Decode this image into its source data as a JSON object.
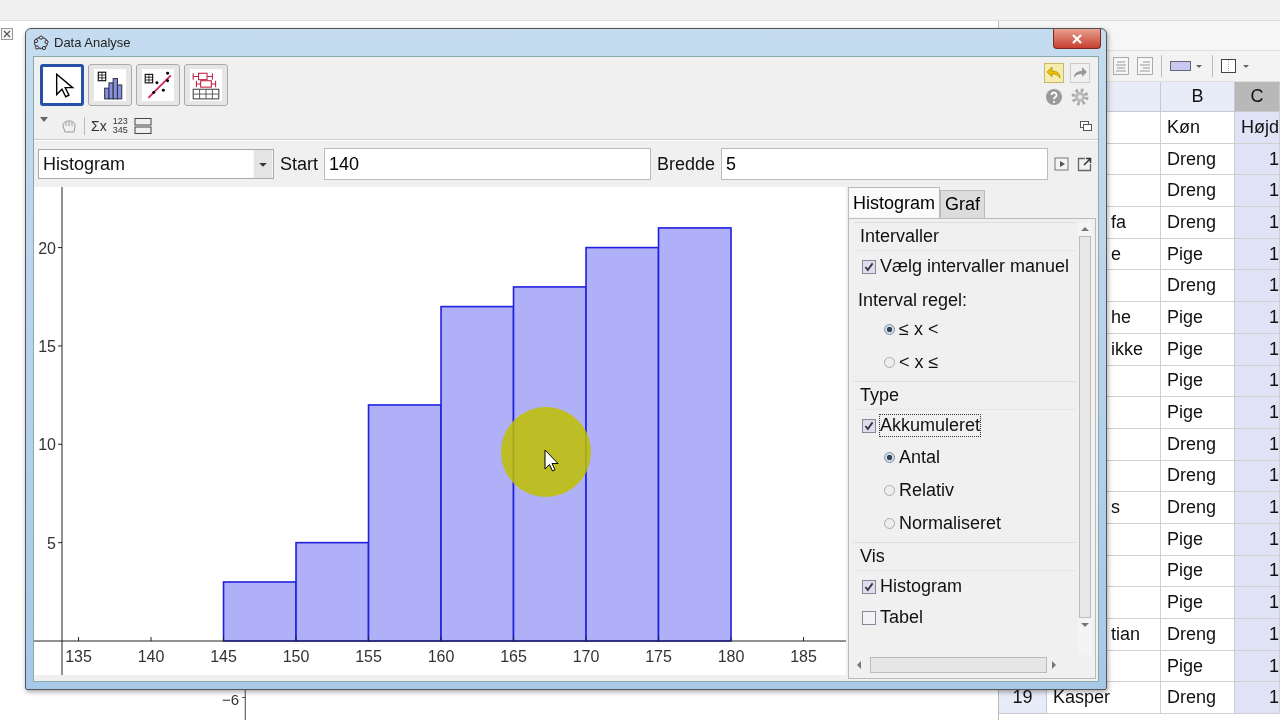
{
  "window": {
    "title": "Data Analyse"
  },
  "toolbar": {
    "modes": [
      {
        "kind": "pointer",
        "selected": true
      },
      {
        "kind": "histogram",
        "selected": false
      },
      {
        "kind": "scatter",
        "selected": false
      },
      {
        "kind": "boxplot",
        "selected": false
      }
    ],
    "statistics_button": "Σx",
    "data_button_lines": [
      "123",
      "345"
    ]
  },
  "controls": {
    "chart_type": "Histogram",
    "start_label": "Start",
    "start_value": "140",
    "width_label": "Bredde",
    "width_value": "5"
  },
  "chart": {
    "chart_data": {
      "type": "bar",
      "x": [
        142.5,
        147.5,
        152.5,
        157.5,
        162.5,
        167.5,
        172.5,
        177.5
      ],
      "values": [
        0,
        3,
        5,
        12,
        17,
        18,
        20,
        21
      ],
      "xlim": [
        133.86,
        187.93
      ],
      "ylim": [
        0,
        23.08
      ],
      "xticks": [
        135,
        140,
        145,
        150,
        155,
        160,
        165,
        170,
        175,
        180,
        185
      ],
      "yticks": [
        5,
        10,
        15,
        20
      ]
    }
  },
  "options": {
    "tabs": [
      {
        "label": "Histogram",
        "selected": true
      },
      {
        "label": "Graf",
        "selected": false
      }
    ],
    "sections": [
      {
        "title": "Intervaller",
        "items": [
          {
            "kind": "checkbox",
            "label": "Vælg intervaller manuel",
            "checked": true,
            "focused": false
          },
          {
            "kind": "caption",
            "label": "Interval regel:"
          },
          {
            "kind": "radio",
            "label": "≤ x <",
            "selected": true
          },
          {
            "kind": "radio",
            "label": "< x ≤",
            "selected": false
          }
        ]
      },
      {
        "title": "Type",
        "items": [
          {
            "kind": "checkbox",
            "label": "Akkumuleret",
            "checked": true,
            "focused": true
          },
          {
            "kind": "radio",
            "label": "Antal",
            "selected": true
          },
          {
            "kind": "radio",
            "label": "Relativ",
            "selected": false
          },
          {
            "kind": "radio",
            "label": "Normaliseret",
            "selected": false
          }
        ]
      },
      {
        "title": "Vis",
        "items": [
          {
            "kind": "checkbox",
            "label": "Histogram",
            "checked": true,
            "focused": false
          },
          {
            "kind": "checkbox",
            "label": "Tabel",
            "checked": false,
            "focused": false
          }
        ]
      }
    ]
  },
  "spreadsheet": {
    "columns": [
      {
        "label": "B",
        "selected": false
      },
      {
        "label": "C",
        "selected": true
      }
    ],
    "rows": [
      {
        "column_b": "Køn",
        "column_c": "Højd"
      },
      {
        "column_b": "Dreng",
        "column_c": "1"
      },
      {
        "column_b": "Dreng",
        "column_c": "1"
      },
      {
        "column_a": "fa",
        "column_b": "Dreng",
        "column_c": "1"
      },
      {
        "column_a": "e",
        "column_b": "Pige",
        "column_c": "1"
      },
      {
        "column_b": "Dreng",
        "column_c": "1"
      },
      {
        "column_a": "he",
        "column_b": "Pige",
        "column_c": "1"
      },
      {
        "column_a": "ikke",
        "column_b": "Pige",
        "column_c": "1"
      },
      {
        "column_b": "Pige",
        "column_c": "1"
      },
      {
        "column_b": "Pige",
        "column_c": "1"
      },
      {
        "column_b": "Dreng",
        "column_c": "1"
      },
      {
        "column_b": "Dreng",
        "column_c": "1"
      },
      {
        "column_a": "s",
        "column_b": "Dreng",
        "column_c": "1"
      },
      {
        "column_b": "Pige",
        "column_c": "1"
      },
      {
        "column_b": "Pige",
        "column_c": "1"
      },
      {
        "column_b": "Pige",
        "column_c": "1"
      },
      {
        "column_a": "tian",
        "column_b": "Dreng",
        "column_c": "1"
      },
      {
        "column_b": "Pige",
        "column_c": "1"
      },
      {
        "number": "19",
        "column_a": "Kasper",
        "column_b": "Dreng",
        "column_c": "1"
      }
    ]
  },
  "graphics_view": {
    "axis_label": "−6"
  }
}
